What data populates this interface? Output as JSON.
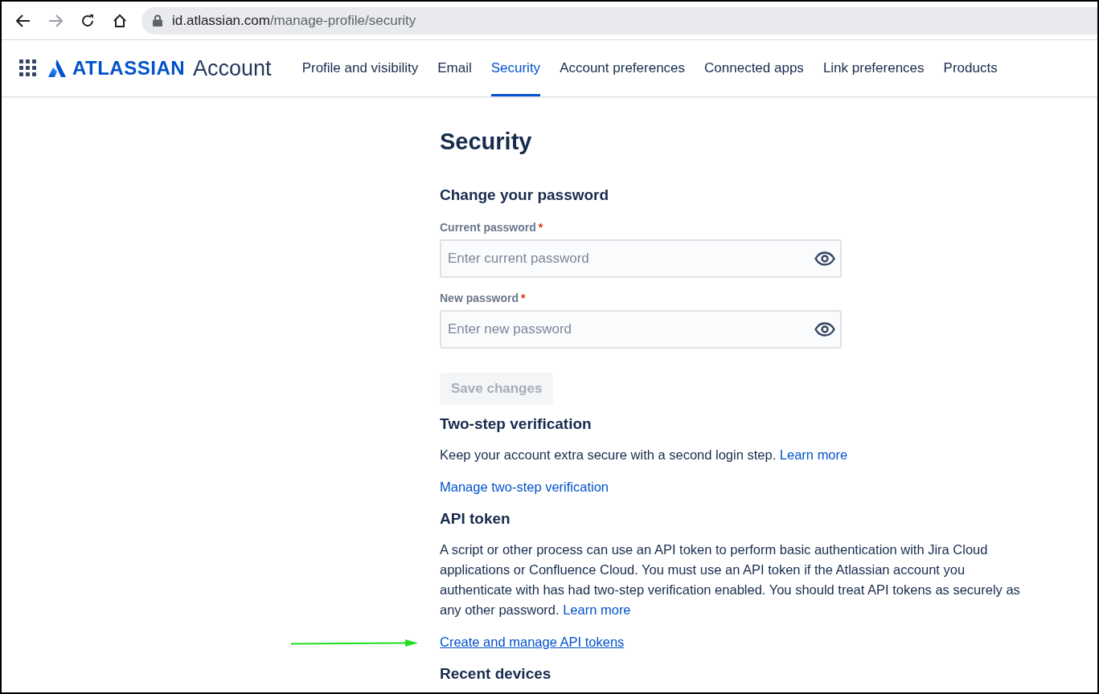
{
  "browser": {
    "url_host": "id.atlassian.com",
    "url_path": "/manage-profile/security"
  },
  "header": {
    "logo_text": "ATLASSIAN",
    "product": "Account",
    "tabs": [
      {
        "label": "Profile and visibility",
        "selected": false
      },
      {
        "label": "Email",
        "selected": false
      },
      {
        "label": "Security",
        "selected": true
      },
      {
        "label": "Account preferences",
        "selected": false
      },
      {
        "label": "Connected apps",
        "selected": false
      },
      {
        "label": "Link preferences",
        "selected": false
      },
      {
        "label": "Products",
        "selected": false
      }
    ]
  },
  "page": {
    "title": "Security",
    "password": {
      "heading": "Change your password",
      "fields": [
        {
          "label": "Current password",
          "required_mark": "*",
          "placeholder": "Enter current password"
        },
        {
          "label": "New password",
          "required_mark": "*",
          "placeholder": "Enter new password"
        }
      ],
      "save_button": {
        "label": "Save changes",
        "disabled": true
      }
    },
    "two_step": {
      "heading": "Two-step verification",
      "text": "Keep your account extra secure with a second login step.",
      "learn_more": "Learn more",
      "manage_link": "Manage two-step verification"
    },
    "api_token": {
      "heading": "API token",
      "text": "A script or other process can use an API token to perform basic authentication with Jira Cloud applications or Confluence Cloud. You must use an API token if the Atlassian account you authenticate with has had two-step verification enabled. You should treat API tokens as securely as any other password.",
      "learn_more": "Learn more",
      "link": "Create and manage API tokens"
    },
    "recent_devices": {
      "heading": "Recent devices"
    }
  }
}
